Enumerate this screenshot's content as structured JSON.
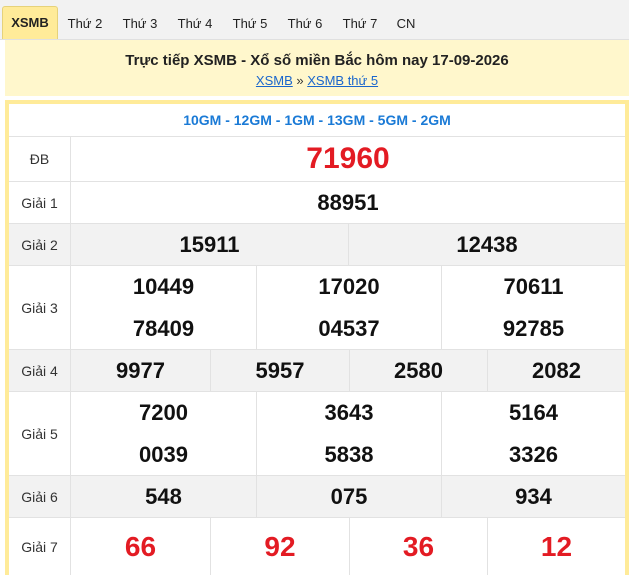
{
  "tabs": [
    {
      "label": "XSMB",
      "active": true
    },
    {
      "label": "Thứ 2",
      "active": false
    },
    {
      "label": "Thứ 3",
      "active": false
    },
    {
      "label": "Thứ 4",
      "active": false
    },
    {
      "label": "Thứ 5",
      "active": false
    },
    {
      "label": "Thứ 6",
      "active": false
    },
    {
      "label": "Thứ 7",
      "active": false
    },
    {
      "label": "CN",
      "active": false
    }
  ],
  "header": {
    "title": "Trực tiếp XSMB - Xổ số miền Bắc hôm nay 17-09-2026",
    "breadcrumb": {
      "link1": "XSMB",
      "separator": "»",
      "link2": "XSMB thứ 5"
    }
  },
  "stations": "10GM - 12GM - 1GM - 13GM - 5GM - 2GM",
  "prizes": {
    "db": {
      "label": "ĐB",
      "values": [
        "71960"
      ]
    },
    "g1": {
      "label": "Giải 1",
      "values": [
        "88951"
      ]
    },
    "g2": {
      "label": "Giải 2",
      "values": [
        "15911",
        "12438"
      ]
    },
    "g3": {
      "label": "Giải 3",
      "values": [
        "10449",
        "17020",
        "70611",
        "78409",
        "04537",
        "92785"
      ]
    },
    "g4": {
      "label": "Giải 4",
      "values": [
        "9977",
        "5957",
        "2580",
        "2082"
      ]
    },
    "g5": {
      "label": "Giải 5",
      "values": [
        "7200",
        "3643",
        "5164",
        "0039",
        "5838",
        "3326"
      ]
    },
    "g6": {
      "label": "Giải 6",
      "values": [
        "548",
        "075",
        "934"
      ]
    },
    "g7": {
      "label": "Giải 7",
      "values": [
        "66",
        "92",
        "36",
        "12"
      ]
    }
  },
  "colors": {
    "accent": "#ffeb99",
    "header_bg": "#fff7cc",
    "red": "#e31b23",
    "link": "#1a66cc",
    "station_blue": "#1a7ad6"
  }
}
